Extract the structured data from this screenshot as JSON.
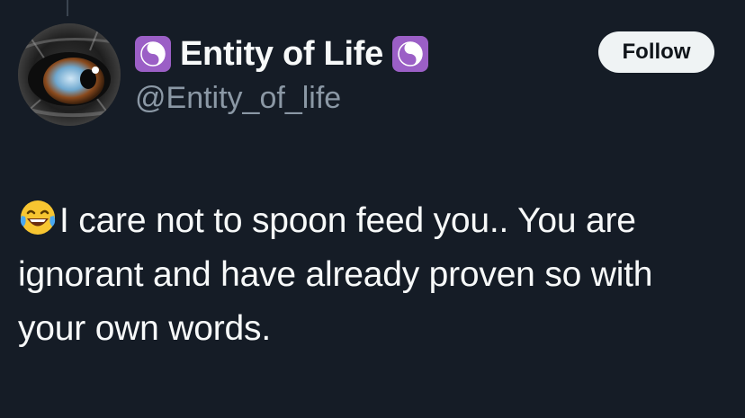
{
  "tweet": {
    "display_name": "Entity of Life",
    "handle": "@Entity_of_life",
    "follow_label": "Follow",
    "text": "I care not to spoon feed you.. You are ignorant and have already proven so with your own words.",
    "leading_emoji": "face-with-tears-of-joy-icon"
  },
  "colors": {
    "background": "#151c26",
    "text_primary": "#f7f9f9",
    "text_secondary": "#8b98a5",
    "badge_purple": "#9b5fc6",
    "follow_bg": "#eff3f4"
  }
}
